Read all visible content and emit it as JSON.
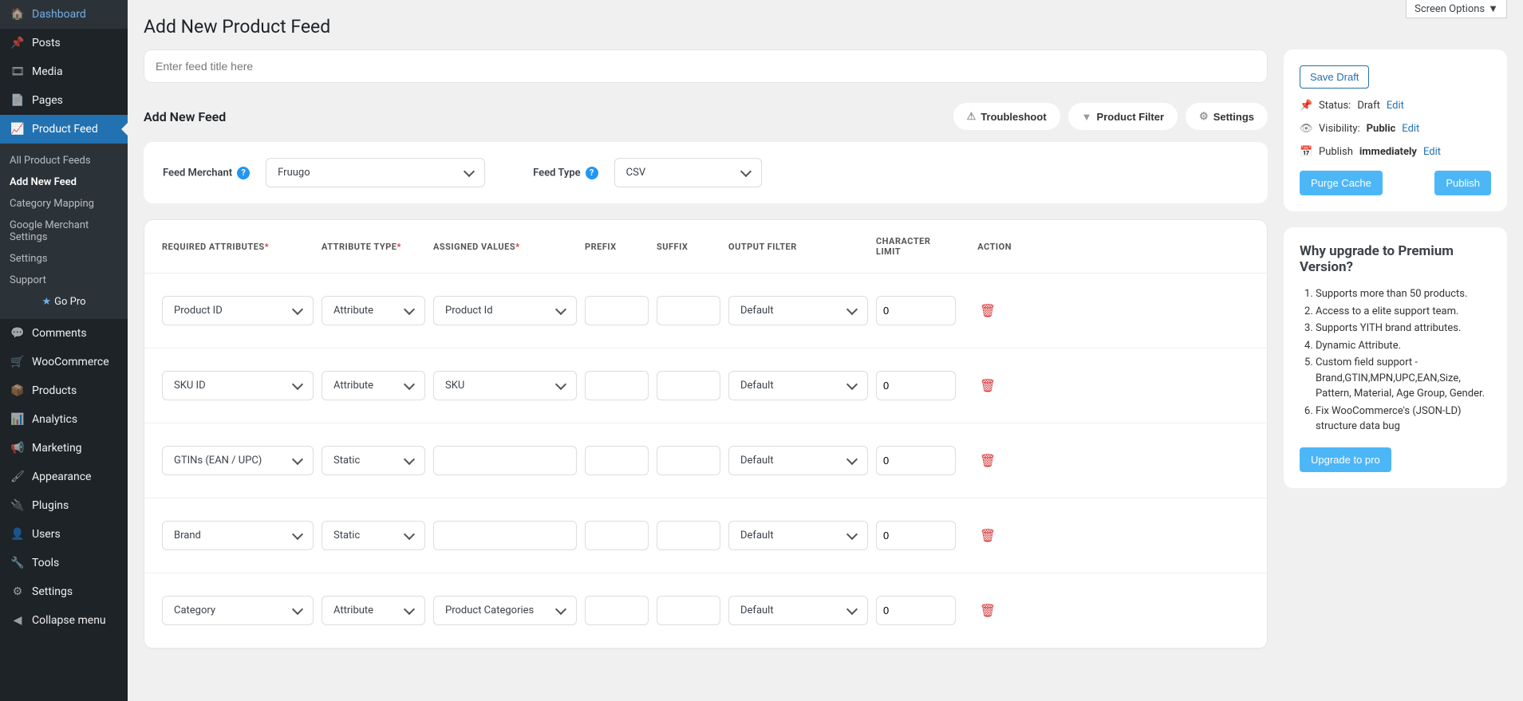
{
  "screenOptions": "Screen Options",
  "sidebar": {
    "items": [
      {
        "label": "Dashboard",
        "icon": "dashboard"
      },
      {
        "label": "Posts",
        "icon": "pin"
      },
      {
        "label": "Media",
        "icon": "media"
      },
      {
        "label": "Pages",
        "icon": "page"
      },
      {
        "label": "Product Feed",
        "icon": "chart",
        "active": true
      },
      {
        "label": "Comments",
        "icon": "comment"
      },
      {
        "label": "WooCommerce",
        "icon": "woo"
      },
      {
        "label": "Products",
        "icon": "box"
      },
      {
        "label": "Analytics",
        "icon": "bars"
      },
      {
        "label": "Marketing",
        "icon": "megaphone"
      },
      {
        "label": "Appearance",
        "icon": "brush"
      },
      {
        "label": "Plugins",
        "icon": "plug"
      },
      {
        "label": "Users",
        "icon": "user"
      },
      {
        "label": "Tools",
        "icon": "wrench"
      },
      {
        "label": "Settings",
        "icon": "sliders"
      },
      {
        "label": "Collapse menu",
        "icon": "collapse"
      }
    ],
    "sub": [
      {
        "label": "All Product Feeds"
      },
      {
        "label": "Add New Feed",
        "current": true
      },
      {
        "label": "Category Mapping"
      },
      {
        "label": "Google Merchant Settings"
      },
      {
        "label": "Settings"
      },
      {
        "label": "Support"
      },
      {
        "label": "Go Pro",
        "gopro": true
      }
    ]
  },
  "page": {
    "title": "Add New Product Feed",
    "titlePlaceholder": "Enter feed title here",
    "sectionTitle": "Add New Feed",
    "buttons": {
      "troubleshoot": "Troubleshoot",
      "filter": "Product Filter",
      "settings": "Settings"
    }
  },
  "config": {
    "merchantLabel": "Feed Merchant",
    "merchantValue": "Fruugo",
    "typeLabel": "Feed Type",
    "typeValue": "CSV"
  },
  "table": {
    "headers": {
      "required": "REQUIRED ATTRIBUTES",
      "type": "ATTRIBUTE TYPE",
      "assigned": "ASSIGNED VALUES",
      "prefix": "PREFIX",
      "suffix": "SUFFIX",
      "output": "OUTPUT FILTER",
      "limit": "CHARACTER LIMIT",
      "action": "ACTION"
    },
    "rows": [
      {
        "attr": "Product ID",
        "type": "Attribute",
        "assigned": "Product Id",
        "output": "Default",
        "limit": "0"
      },
      {
        "attr": "SKU ID",
        "type": "Attribute",
        "assigned": "SKU",
        "output": "Default",
        "limit": "0"
      },
      {
        "attr": "GTINs (EAN / UPC)",
        "type": "Static",
        "assigned": "",
        "output": "Default",
        "limit": "0"
      },
      {
        "attr": "Brand",
        "type": "Static",
        "assigned": "",
        "output": "Default",
        "limit": "0"
      },
      {
        "attr": "Category",
        "type": "Attribute",
        "assigned": "Product Categories",
        "output": "Default",
        "limit": "0"
      }
    ]
  },
  "publish": {
    "saveDraft": "Save Draft",
    "statusLabel": "Status:",
    "statusValue": "Draft",
    "visibilityLabel": "Visibility:",
    "visibilityValue": "Public",
    "publishLabel": "Publish",
    "publishValue": "immediately",
    "edit": "Edit",
    "purge": "Purge Cache",
    "publishBtn": "Publish"
  },
  "upgrade": {
    "title": "Why upgrade to Premium Version?",
    "items": [
      "Supports more than 50 products.",
      "Access to a elite support team.",
      "Supports YITH brand attributes.",
      "Dynamic Attribute.",
      "Custom field support - Brand,GTIN,MPN,UPC,EAN,Size, Pattern, Material, Age Group, Gender.",
      "Fix WooCommerce's (JSON-LD) structure data bug"
    ],
    "btn": "Upgrade to pro"
  }
}
